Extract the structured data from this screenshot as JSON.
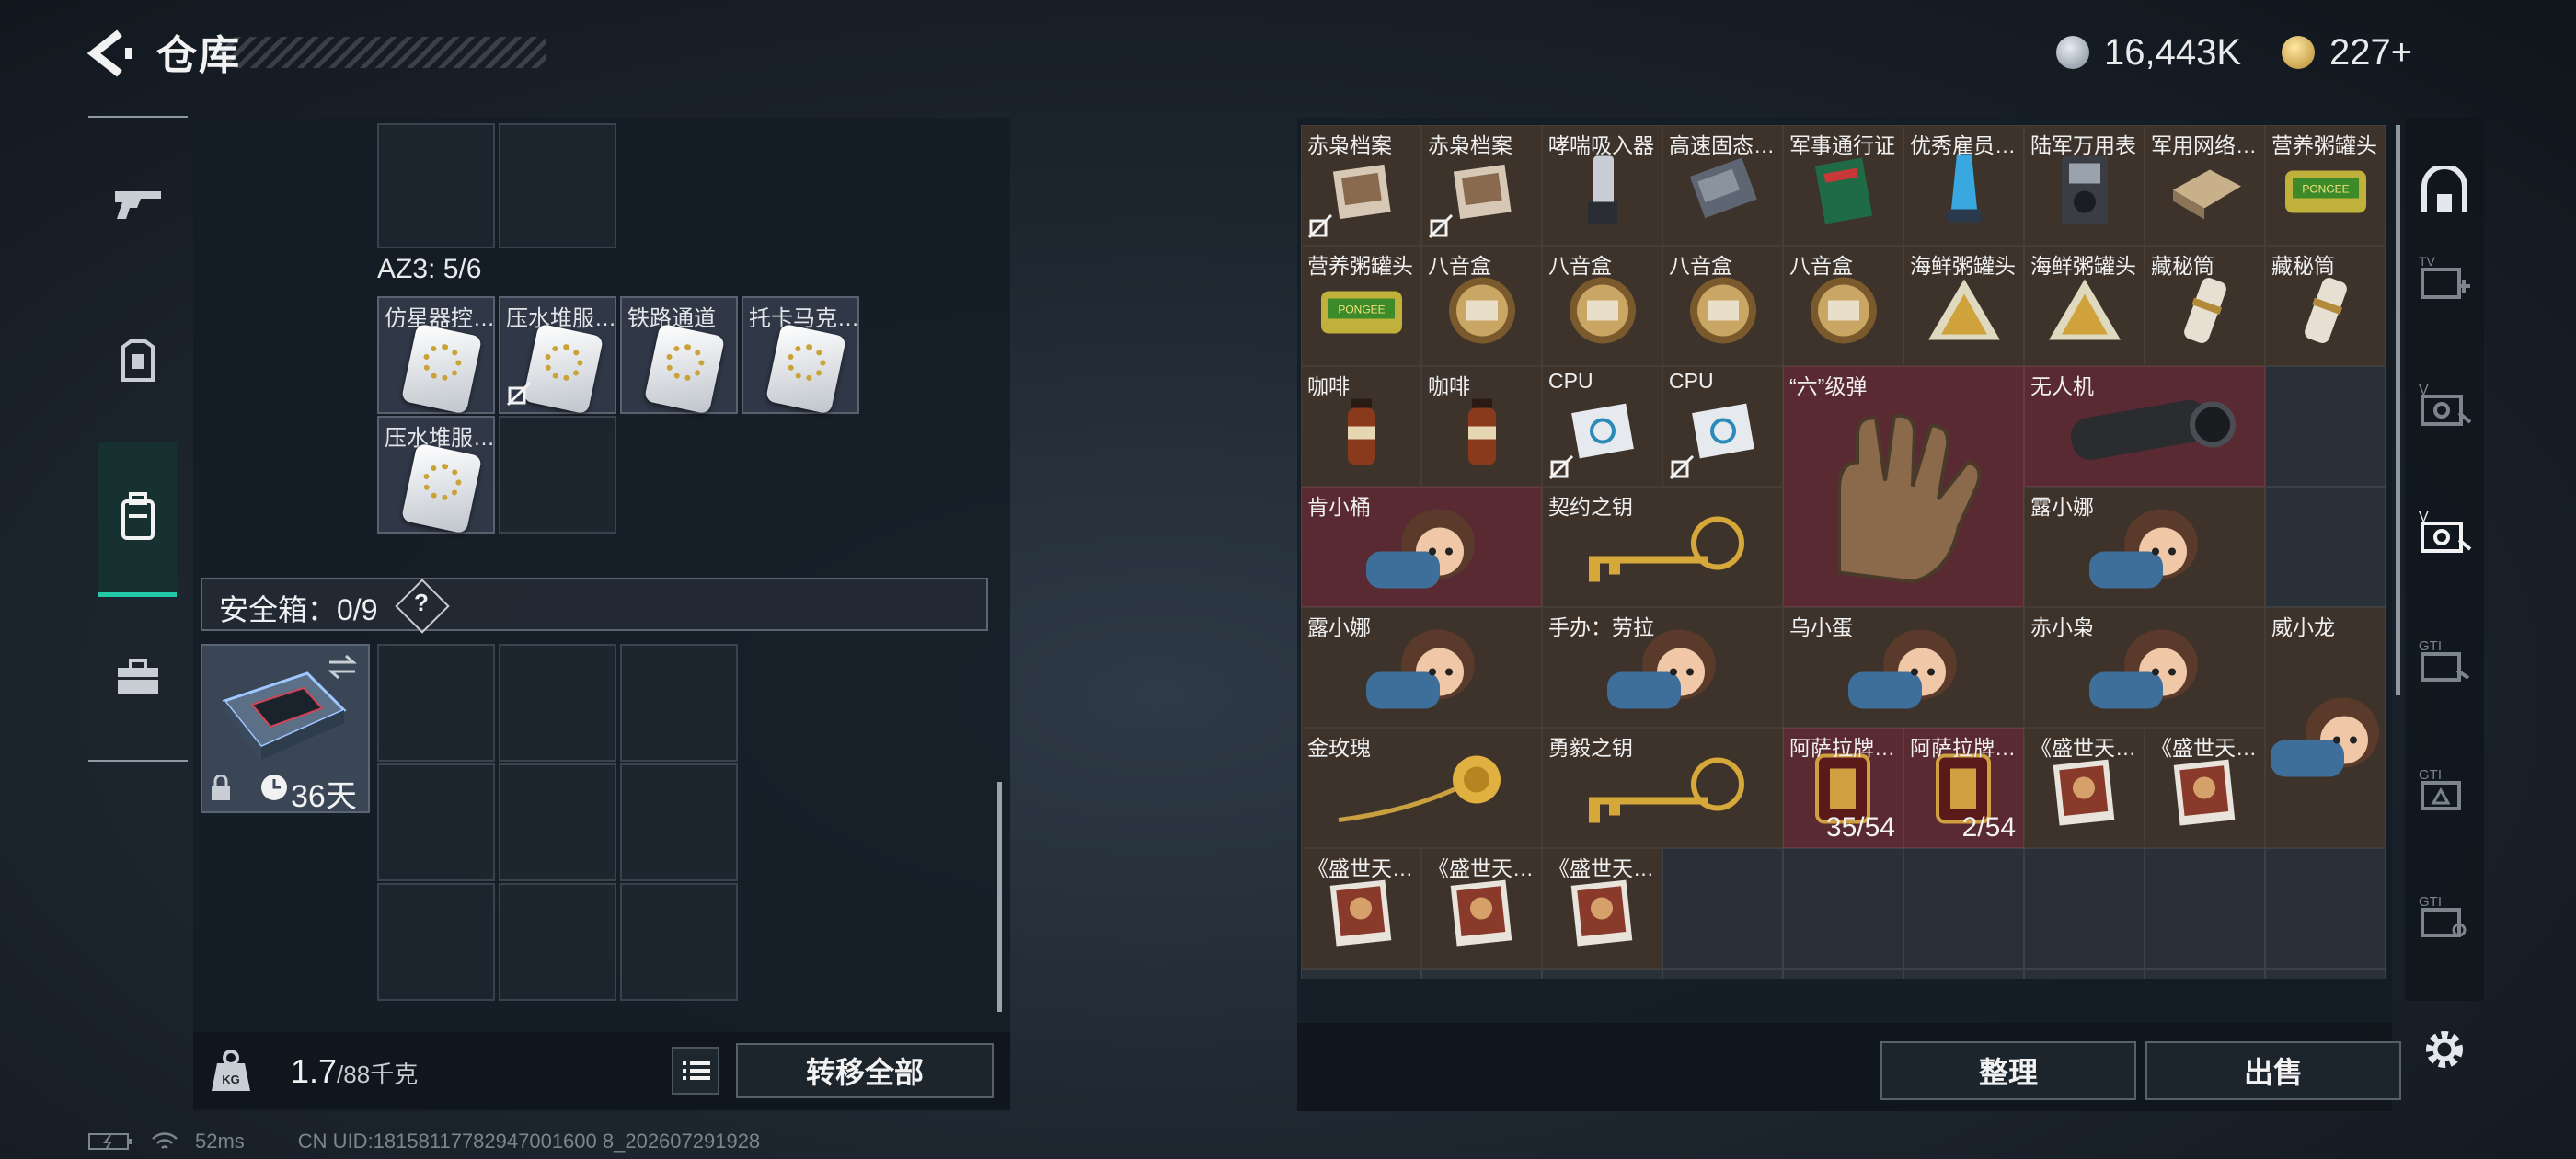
{
  "header": {
    "title": "仓库",
    "currencies": [
      {
        "icon": "silver-coin-icon",
        "value": "16,443K"
      },
      {
        "icon": "gold-coin-icon",
        "value": "227+"
      }
    ]
  },
  "left_nav": [
    {
      "icon": "gun-icon",
      "active": false
    },
    {
      "icon": "armor-icon",
      "active": false
    },
    {
      "icon": "backpack-icon",
      "active": true
    },
    {
      "icon": "briefcase-icon",
      "active": false
    }
  ],
  "az3": {
    "label": "AZ3: 5/6",
    "items": [
      "仿星器控…",
      "压水堆服…",
      "铁路通道",
      "托卡马克…",
      "压水堆服…"
    ]
  },
  "safe_box": {
    "label": "安全箱：0/9",
    "help": "?",
    "days": "36天"
  },
  "weight": {
    "current": "1.7",
    "max": "/88千克",
    "icon_label": "KG"
  },
  "transfer_all_label": "转移全部",
  "stash_items": [
    {
      "name": "赤枭档案"
    },
    {
      "name": "赤枭档案"
    },
    {
      "name": "哮喘吸入器"
    },
    {
      "name": "高速固态…"
    },
    {
      "name": "军事通行证"
    },
    {
      "name": "优秀雇员…"
    },
    {
      "name": "陆军万用表"
    },
    {
      "name": "军用网络…"
    },
    {
      "name": "营养粥罐头"
    },
    {
      "name": "营养粥罐头"
    },
    {
      "name": "八音盒"
    },
    {
      "name": "八音盒"
    },
    {
      "name": "八音盒"
    },
    {
      "name": "八音盒"
    },
    {
      "name": "海鲜粥罐头"
    },
    {
      "name": "海鲜粥罐头"
    },
    {
      "name": "藏秘筒"
    },
    {
      "name": "藏秘筒"
    },
    {
      "name": "咖啡"
    },
    {
      "name": "咖啡"
    },
    {
      "name": "CPU"
    },
    {
      "name": "CPU"
    },
    {
      "name": "“六”级弹"
    },
    {
      "name": "无人机"
    },
    {
      "name": "肯小桶"
    },
    {
      "name": "契约之钥"
    },
    {
      "name": "露小娜"
    },
    {
      "name": "露小娜"
    },
    {
      "name": "手办：劳拉"
    },
    {
      "name": "乌小蛋"
    },
    {
      "name": "赤小枭"
    },
    {
      "name": "威小龙"
    },
    {
      "name": "金玫瑰"
    },
    {
      "name": "勇毅之钥"
    },
    {
      "name": "阿萨拉牌…",
      "count": "35/54"
    },
    {
      "name": "阿萨拉牌…",
      "count": "2/54"
    },
    {
      "name": "《盛世天…"
    },
    {
      "name": "《盛世天…"
    },
    {
      "name": "《盛世天…"
    },
    {
      "name": "《盛世天…"
    },
    {
      "name": "《盛世天…"
    }
  ],
  "buttons": {
    "sort": "整理",
    "sell": "出售"
  },
  "right_nav": [
    "home-shield-icon",
    "tv-plus-icon",
    "v-card-icon",
    "v-card-active-icon",
    "gti-1-icon",
    "gti-2-icon",
    "gti-3-icon"
  ],
  "status_bar": {
    "ping": "52ms",
    "uid": "CN UID:18158117782947001600 8_202607291928"
  }
}
